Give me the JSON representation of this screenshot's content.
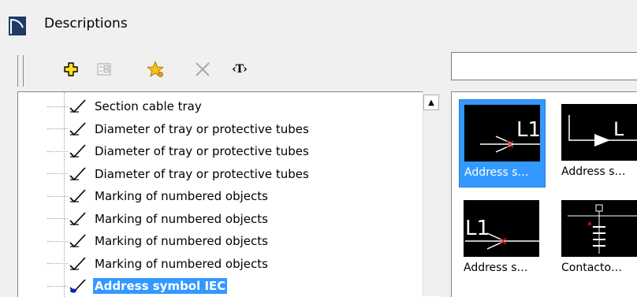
{
  "window": {
    "title": "Descriptions"
  },
  "search": {
    "value": ""
  },
  "toolbar": {
    "text_tool_label": "‹T›"
  },
  "tree": {
    "items": [
      {
        "label": "Section cable tray"
      },
      {
        "label": "Diameter of tray or protective tubes"
      },
      {
        "label": "Diameter of tray or protective tubes"
      },
      {
        "label": "Diameter of tray or protective tubes"
      },
      {
        "label": "Marking of numbered objects"
      },
      {
        "label": "Marking of numbered objects"
      },
      {
        "label": "Marking of numbered objects"
      },
      {
        "label": "Marking of numbered objects"
      },
      {
        "label": "Address symbol IEC",
        "selected": true
      }
    ]
  },
  "gallery": {
    "tiles": [
      {
        "label": "Address s…",
        "selected": true
      },
      {
        "label": "Address s…"
      },
      {
        "label": "Address s…"
      },
      {
        "label": "Contacto…"
      }
    ]
  },
  "colors": {
    "selection": "#3399ff",
    "tile_bg": "#000000",
    "accent_red": "#e02020"
  }
}
